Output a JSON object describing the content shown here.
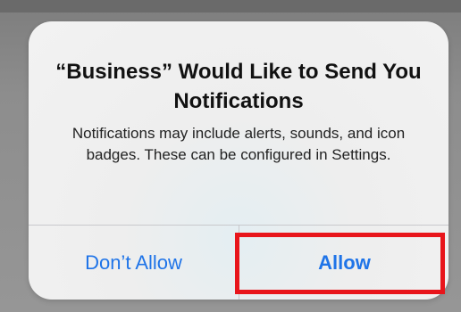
{
  "alert": {
    "title": "“Business” Would Like to Send You Notifications",
    "message": "Notifications may include alerts, sounds, and icon badges. These can be configured in Settings.",
    "buttons": {
      "dont_allow": "Don’t Allow",
      "allow": "Allow"
    }
  },
  "colors": {
    "button_text": "#1f74e8",
    "highlight": "#e8151b"
  }
}
